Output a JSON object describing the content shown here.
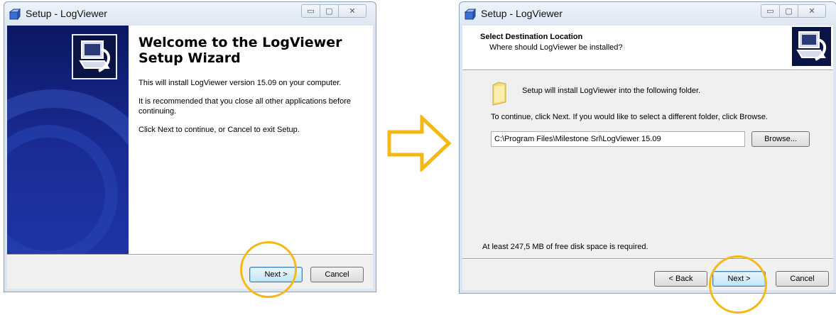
{
  "window1": {
    "title": "Setup - LogViewer",
    "controls": {
      "minimize": "▭",
      "maximize": "▢",
      "close": "✕"
    },
    "welcome_title": "Welcome to the LogViewer Setup Wizard",
    "p1": "This will install LogViewer version 15.09 on your computer.",
    "p2": "It is recommended that you close all other applications before continuing.",
    "p3": "Click Next to continue, or Cancel to exit Setup.",
    "next_label": "Next >",
    "cancel_label": "Cancel"
  },
  "window2": {
    "title": "Setup - LogViewer",
    "controls": {
      "minimize": "▭",
      "maximize": "▢",
      "close": "✕"
    },
    "header_title": "Select Destination Location",
    "header_subtitle": "Where should LogViewer be installed?",
    "install_text": "Setup will install LogViewer into the following folder.",
    "continue_text": "To continue, click Next. If you would like to select a different folder, click Browse.",
    "path_value": "C:\\Program Files\\Milestone Srl\\LogViewer 15.09",
    "browse_label": "Browse...",
    "disk_space_text": "At least 247,5 MB of free disk space is required.",
    "back_label": "< Back",
    "next_label": "Next >",
    "cancel_label": "Cancel"
  },
  "colors": {
    "highlight": "#f4b914",
    "side_panel": "#1a2c95",
    "window_frame": "#d9e5f2"
  },
  "icons": {
    "app": "setup-box-icon",
    "folder": "folder-icon",
    "arrow": "right-arrow-icon"
  }
}
